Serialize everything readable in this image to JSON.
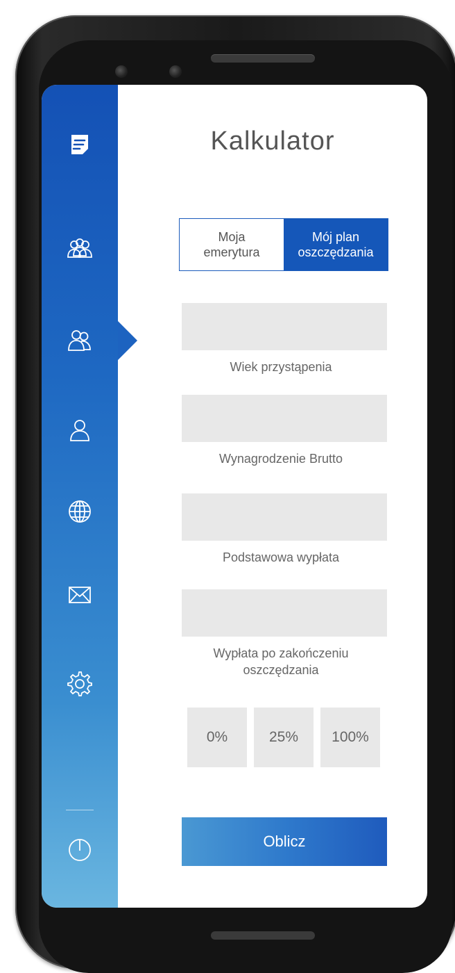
{
  "screen": {
    "title": "Kalkulator",
    "tabs": [
      {
        "label": "Moja\nemerytura",
        "active": false
      },
      {
        "label": "Mój plan\noszczędzania",
        "active": true
      }
    ],
    "fields": [
      {
        "label": "Wiek przystąpenia",
        "value": ""
      },
      {
        "label": "Wynagrodzenie Brutto",
        "value": ""
      },
      {
        "label": "Podstawowa wypłata",
        "value": ""
      },
      {
        "label": "Wypłata po zakończeniu\noszczędzania",
        "value": ""
      }
    ],
    "percent_options": [
      "0%",
      "25%",
      "100%"
    ],
    "calculate_label": "Oblicz"
  },
  "sidebar": {
    "items": [
      {
        "icon": "document-icon"
      },
      {
        "icon": "group-icon"
      },
      {
        "icon": "two-users-icon",
        "active": true
      },
      {
        "icon": "user-icon"
      },
      {
        "icon": "globe-icon"
      },
      {
        "icon": "mail-icon"
      },
      {
        "icon": "gear-icon"
      },
      {
        "icon": "power-icon"
      }
    ]
  },
  "colors": {
    "brand_blue": "#1557b9",
    "field_gray": "#e8e8e8",
    "text_gray": "#666666"
  }
}
